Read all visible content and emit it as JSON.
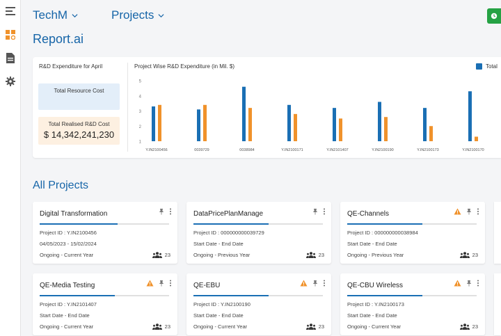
{
  "nav": {
    "items": [
      {
        "icon": "menu-icon"
      },
      {
        "icon": "dashboard-icon"
      },
      {
        "icon": "document-icon"
      },
      {
        "icon": "settings-icon"
      }
    ]
  },
  "header": {
    "org": "TechM",
    "project_selector": "Projects",
    "app_title": "Report.ai",
    "accent_color": "#1665a8",
    "action_color": "#25a244"
  },
  "summary": {
    "left_title": "R&D Expenditure for April",
    "resource_cost_label": "Total Resource Cost",
    "realised_label": "Total Realised R&D Cost",
    "realised_value": "$ 14,342,241,230"
  },
  "chart_data": {
    "type": "bar",
    "title": "Project Wise R&D Expenditure (in Mil. $)",
    "categories": [
      "Y.IN2100456",
      "0039729",
      "0038984",
      "Y.IN2100171",
      "Y.IN2101407",
      "Y.IN2100190",
      "Y.IN2100173",
      "Y.IN2100170"
    ],
    "series": [
      {
        "name": "Total",
        "color": "#1a6fb4",
        "values": [
          3.3,
          3.1,
          4.6,
          3.4,
          3.2,
          3.6,
          3.2,
          4.3
        ]
      },
      {
        "color": "#f0922b",
        "values": [
          3.4,
          3.4,
          3.2,
          2.8,
          2.5,
          2.6,
          2.0,
          1.3
        ]
      }
    ],
    "yticks": [
      "1",
      "2",
      "3",
      "4",
      "5"
    ],
    "ylim": [
      1,
      5
    ],
    "legend_position": "top-right",
    "grid": false
  },
  "projects": {
    "title": "All Projects",
    "members_icon": "people-icon",
    "warning_color": "#f0922b",
    "cards": [
      {
        "name": "Digital Transformation",
        "id": "Project ID : Y.IN2100456",
        "dates": "04/05/2023 - 15/02/2024",
        "status": "Ongoing - Current Year",
        "members": "23",
        "warning": false,
        "progress": 0.6
      },
      {
        "name": "DataPricePlanManage",
        "id": "Project ID : 000000000039729",
        "dates": "Start Date - End Date",
        "status": "Ongoing - Previous Year",
        "members": "23",
        "warning": false,
        "progress": 0.58
      },
      {
        "name": "QE-Channels",
        "id": "Project ID : 000000000038984",
        "dates": "Start Date - End Date",
        "status": "Ongoing - Previous Year",
        "members": "23",
        "warning": true,
        "progress": 0.58
      },
      {
        "name": "QE-Media Testing",
        "id": "Project ID : Y.IN2101407",
        "dates": "Start Date - End Date",
        "status": "Ongoing - Current Year",
        "members": "23",
        "warning": true,
        "progress": 0.58
      },
      {
        "name": "QE-EBU",
        "id": "Project ID : Y.IN2100190",
        "dates": "Start Date - End Date",
        "status": "Ongoing - Current Year",
        "members": "23",
        "warning": true,
        "progress": 0.58
      },
      {
        "name": "QE-CBU Wireless",
        "id": "Project ID : Y.IN2100173",
        "dates": "Start Date - End Date",
        "status": "Ongoing - Current Year",
        "members": "23",
        "warning": true,
        "progress": 0.58
      }
    ]
  }
}
